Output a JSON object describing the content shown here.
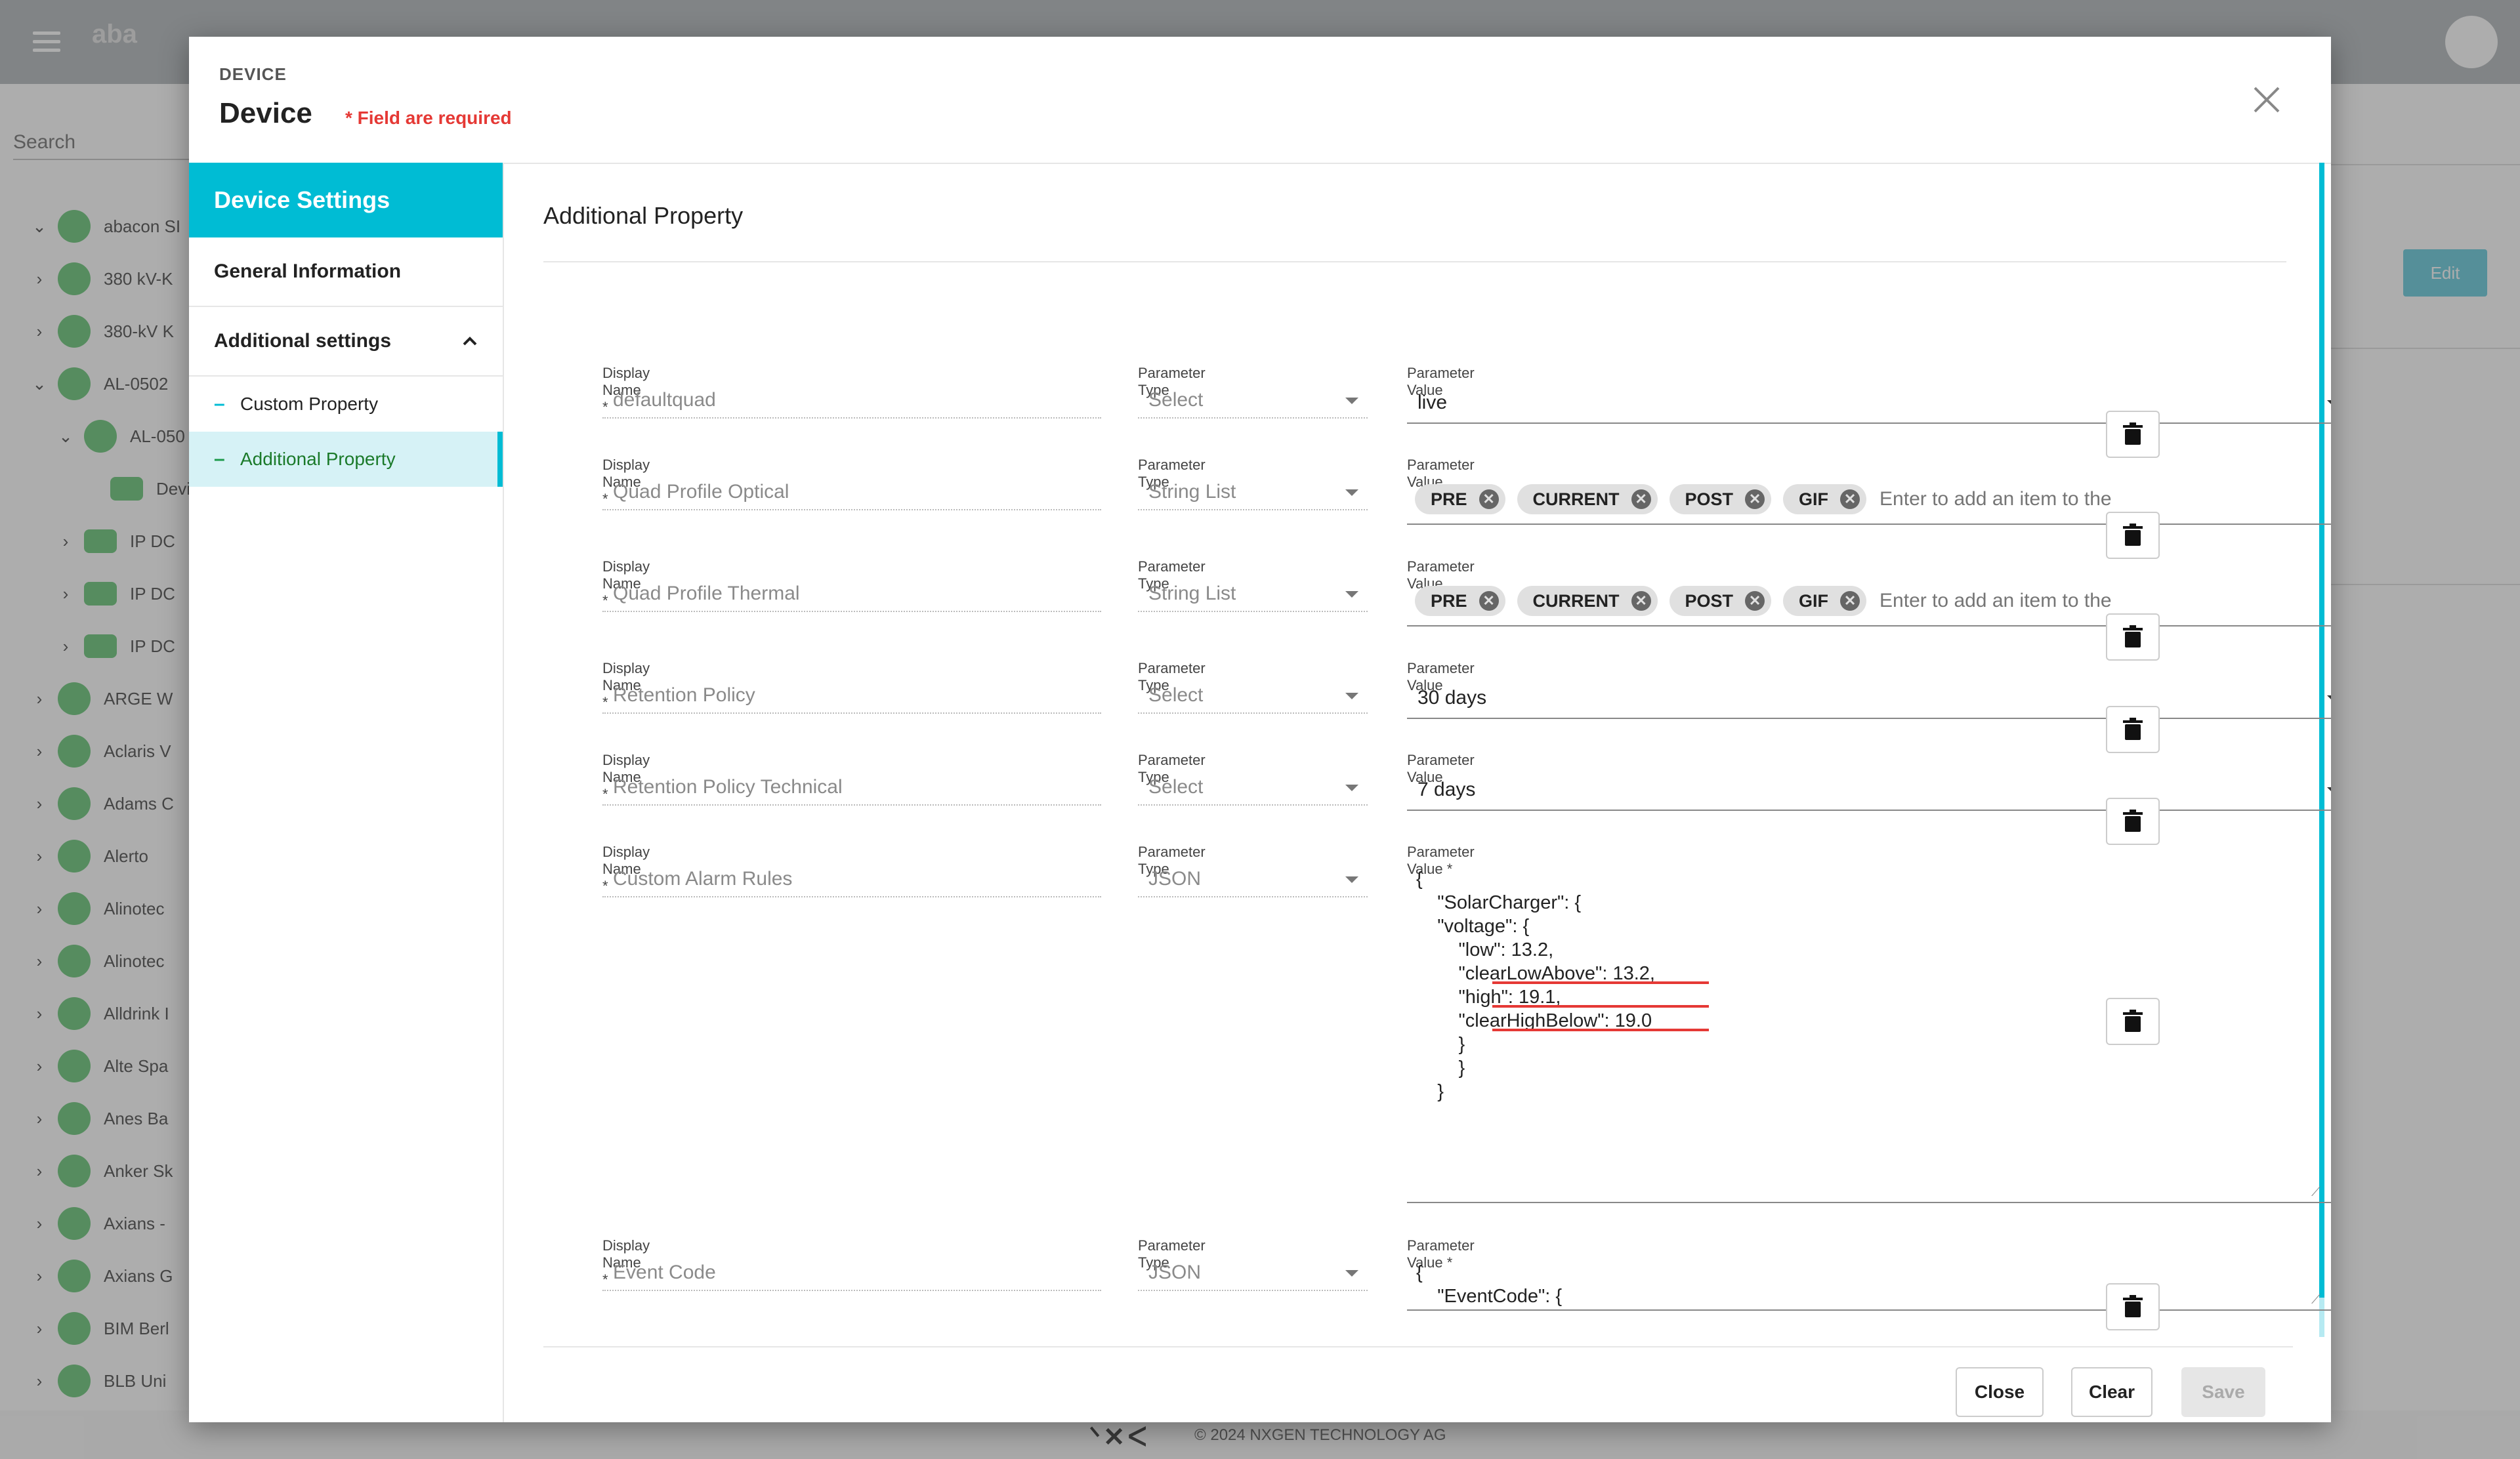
{
  "background": {
    "search_placeholder": "Search",
    "logo": "aba",
    "edit_label": "Edit",
    "footer_text": "© 2024 NXGEN TECHNOLOGY AG",
    "tree": [
      "abacon SI",
      "380 kV-K",
      "380-kV K",
      "AL-0502",
      "AL-050",
      "Devi",
      "IP DC",
      "IP DC",
      "IP DC",
      "ARGE W",
      "Aclaris V",
      "Adams C",
      "Alerto",
      "Alinotec",
      "Alinotec",
      "Alldrink I",
      "Alte Spa",
      "Anes Ba",
      "Anker Sk",
      "Axians -",
      "Axians G",
      "BIM Berl",
      "BLB Uni"
    ]
  },
  "modal": {
    "overline": "DEVICE",
    "title": "Device",
    "required_note": "* Field are required"
  },
  "sidebar": {
    "header": "Device Settings",
    "items": [
      {
        "label": "General Information"
      },
      {
        "label": "Additional settings"
      }
    ],
    "subitems": [
      {
        "label": "Custom Property"
      },
      {
        "label": "Additional Property"
      }
    ]
  },
  "content": {
    "section_title": "Additional Property",
    "labels": {
      "display_name": "Display Name *",
      "parameter_type": "Parameter Type",
      "parameter_value": "Parameter Value",
      "parameter_value_required": "Parameter Value *"
    },
    "chip_placeholder": "Enter to add an item to the",
    "rows": [
      {
        "display_name": "defaultquad",
        "parameter_type": "Select",
        "parameter_value": "live"
      },
      {
        "display_name": "Quad Profile Optical",
        "parameter_type": "String List",
        "chips": [
          "PRE",
          "CURRENT",
          "POST",
          "GIF"
        ]
      },
      {
        "display_name": "Quad Profile Thermal",
        "parameter_type": "String List",
        "chips": [
          "PRE",
          "CURRENT",
          "POST",
          "GIF"
        ]
      },
      {
        "display_name": "Retention Policy",
        "parameter_type": "Select",
        "parameter_value": "30 days"
      },
      {
        "display_name": "Retention Policy Technical",
        "parameter_type": "Select",
        "parameter_value": "7 days"
      },
      {
        "display_name": "Custom Alarm Rules",
        "parameter_type": "JSON",
        "json": "{\n    \"SolarCharger\": {\n    \"voltage\": {\n        \"low\": 13.2,\n        \"clearLowAbove\": 13.2,\n        \"high\": 19.1,\n        \"clearHighBelow\": 19.0\n        }\n        }\n    }"
      },
      {
        "display_name": "Event Code",
        "parameter_type": "JSON",
        "json": "{\n    \"EventCode\": {"
      }
    ]
  },
  "footer": {
    "close_label": "Close",
    "clear_label": "Clear",
    "save_label": "Save"
  },
  "colors": {
    "accent": "#00bcd4",
    "required": "#e53935",
    "active_text": "#1b7a2a"
  }
}
